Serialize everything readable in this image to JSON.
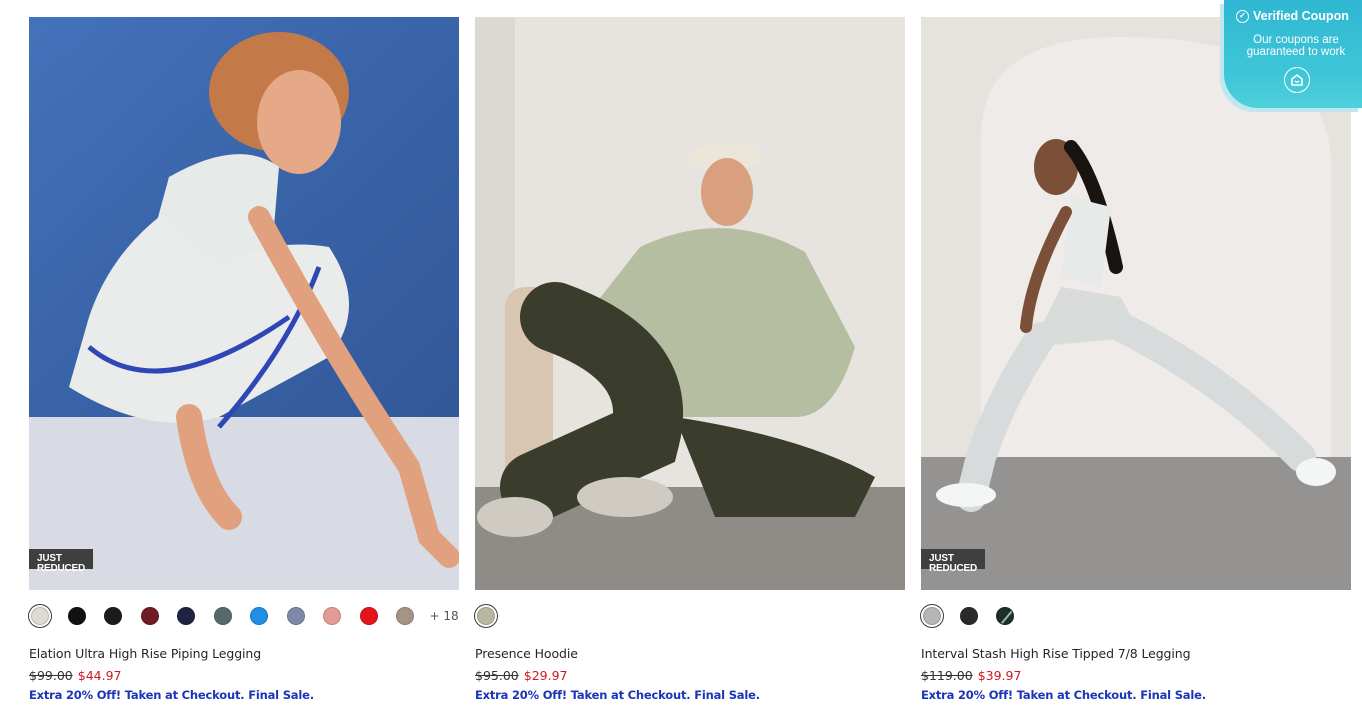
{
  "products": [
    {
      "name": "Elation Ultra High Rise Piping Legging",
      "badge": "JUST REDUCED",
      "old_price": "$99.00",
      "new_price": "$44.97",
      "promo": "Extra 20% Off! Taken at Checkout. Final Sale.",
      "swatches": [
        "#dedbd3",
        "#111111",
        "#1b1b1b",
        "#6e1d25",
        "#1f2540",
        "#58696c",
        "#1f8ee3",
        "#7d8aa6",
        "#e49a95",
        "#e5131b",
        "#a39484"
      ],
      "more_colors": "+ 18",
      "image": "woman-crouching-white-leggings"
    },
    {
      "name": "Presence Hoodie",
      "badge": "",
      "old_price": "$95.00",
      "new_price": "$29.97",
      "promo": "Extra 20% Off! Taken at Checkout. Final Sale.",
      "swatches": [
        "#b9b7a0"
      ],
      "more_colors": "",
      "image": "woman-sitting-sage-hoodie"
    },
    {
      "name": "Interval Stash High Rise Tipped 7/8 Legging",
      "badge": "JUST REDUCED",
      "old_price": "$119.00",
      "new_price": "$39.97",
      "promo": "Extra 20% Off! Taken at Checkout. Final Sale.",
      "swatches": [
        "#b5b5b3",
        "#2a2a2a",
        "#1f2e2a"
      ],
      "more_colors": "",
      "image": "woman-lunging-grey-leggings"
    }
  ],
  "coupon": {
    "title": "Verified Coupon",
    "subtitle": "Our coupons are guaranteed to work",
    "icon": "coupon-logo-icon"
  },
  "colors": {
    "sale_red": "#d0181f",
    "promo_blue": "#1c34b8",
    "coupon_teal": "#2fb7d2"
  }
}
